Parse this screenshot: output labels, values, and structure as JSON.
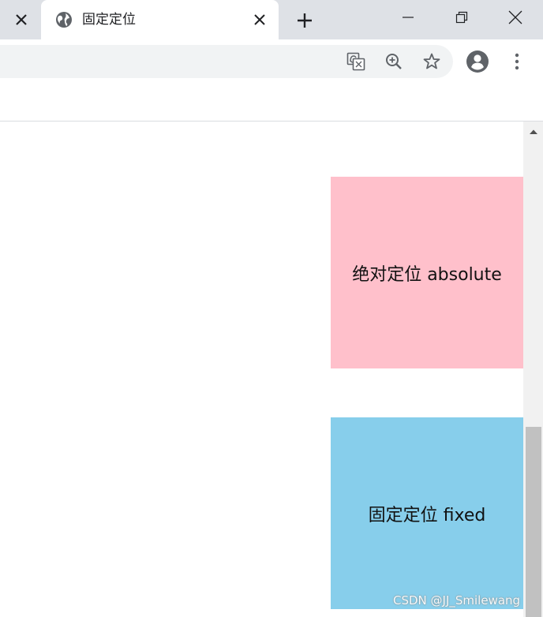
{
  "browser": {
    "tab": {
      "title": "固定定位",
      "favicon_icon": "globe-icon"
    },
    "icons": {
      "prev_tab_close": "close-icon",
      "tab_close": "close-icon",
      "new_tab": "plus-icon",
      "minimize": "minimize-icon",
      "restore": "restore-icon",
      "close": "close-icon",
      "translate": "translate-icon",
      "zoom": "zoom-in-icon",
      "bookmark": "star-icon",
      "profile": "account-icon",
      "menu": "kebab-menu-icon"
    }
  },
  "page": {
    "absolute_box": {
      "label": "绝对定位 absolute",
      "color": "#ffc0cb"
    },
    "fixed_box": {
      "label": "固定定位 fixed",
      "color": "#87ceeb"
    }
  },
  "watermark": "CSDN @JJ_Smilewang"
}
